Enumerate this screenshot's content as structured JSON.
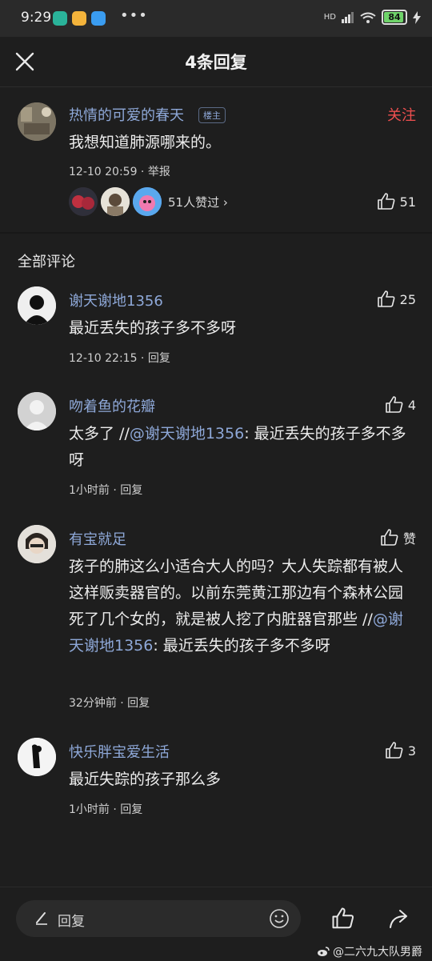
{
  "status_bar": {
    "time": "9:29",
    "dots": "•••",
    "network": "HD",
    "battery": "84"
  },
  "header": {
    "title": "4条回复"
  },
  "main_post": {
    "username": "热情的可爱的春天",
    "badge": "楼主",
    "follow_label": "关注",
    "content": "我想知道肺源哪来的。",
    "meta": "12-10 20:59 · 举报",
    "likers_text": "51人赞过 ›",
    "like_count": "51"
  },
  "section_title": "全部评论",
  "comments": [
    {
      "username": "谢天谢地1356",
      "content": "最近丢失的孩子多不多呀",
      "meta": "12-10 22:15 · 回复",
      "like_count": "25"
    },
    {
      "username": "吻着鱼的花瓣",
      "content_prefix": "太多了 //",
      "mention": "@谢天谢地1356",
      "content_suffix": ": 最近丢失的孩子多不多呀",
      "meta": "1小时前 · 回复",
      "like_count": "4"
    },
    {
      "username": "有宝就足",
      "content_prefix": "孩子的肺这么小适合大人的吗？大人失踪都有被人这样贩卖器官的。以前东莞黄江那边有个森林公园死了几个女的，就是被人挖了内脏器官那些 //",
      "mention": "@谢天谢地1356",
      "content_suffix": ": 最近丢失的孩子多不多呀",
      "meta": "32分钟前 · 回复",
      "like_count": "赞"
    },
    {
      "username": "快乐胖宝爱生活",
      "content": "最近失踪的孩子那么多",
      "meta": "1小时前 · 回复",
      "like_count": "3"
    }
  ],
  "bottom_bar": {
    "reply_placeholder": "回复",
    "watermark": "@二六九大队男爵"
  },
  "colors": {
    "background": "#1e1e1e",
    "username": "#8ea8d8",
    "follow": "#ef4f4f",
    "text": "#ececec"
  }
}
